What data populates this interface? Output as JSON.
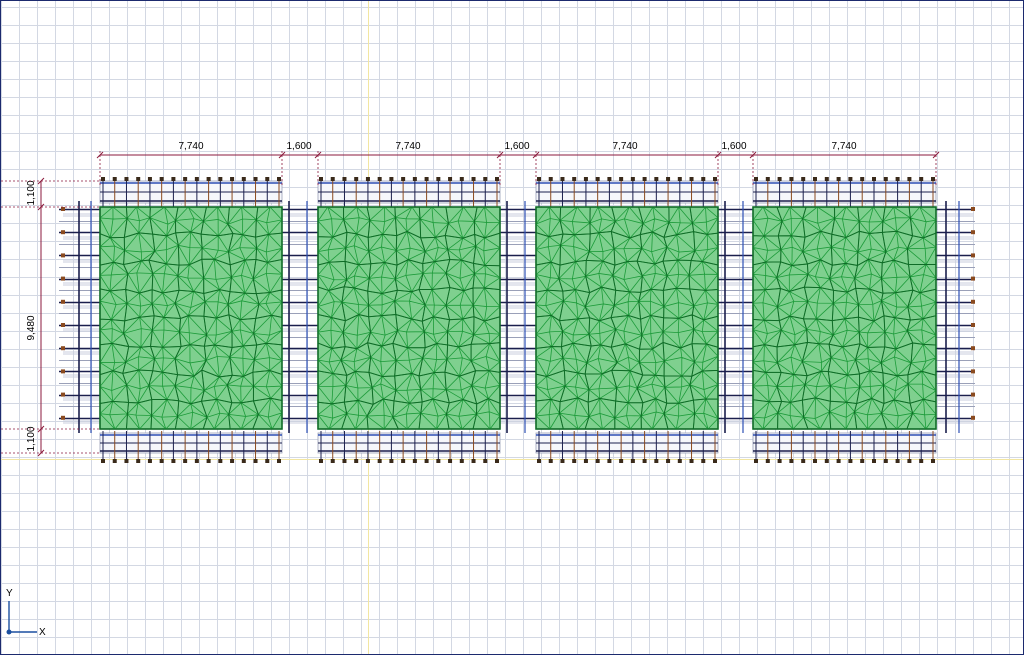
{
  "drawing": {
    "dimensions": {
      "horizontal": [
        "7,740",
        "1,600",
        "7,740",
        "1,600",
        "7,740",
        "1,600",
        "7,740"
      ],
      "vertical": [
        "1,100",
        "9,480",
        "1,100"
      ]
    },
    "axis": {
      "x_label": "X",
      "y_label": "Y"
    },
    "colors": {
      "background": "#ffffff",
      "grid": "#d3d8e3",
      "grid_accent": "#f2e6a2",
      "dimension": "#8b1a3c",
      "mesh": "#1d9b3a",
      "mesh_dark": "#0f6b27",
      "beam_dark": "#1b1f4d",
      "beam_blue": "#2d4fb5",
      "post": "#8a4a1f",
      "axis": "#1a4fa0",
      "frame": "#1c2a6e"
    },
    "panel_count": 4
  }
}
